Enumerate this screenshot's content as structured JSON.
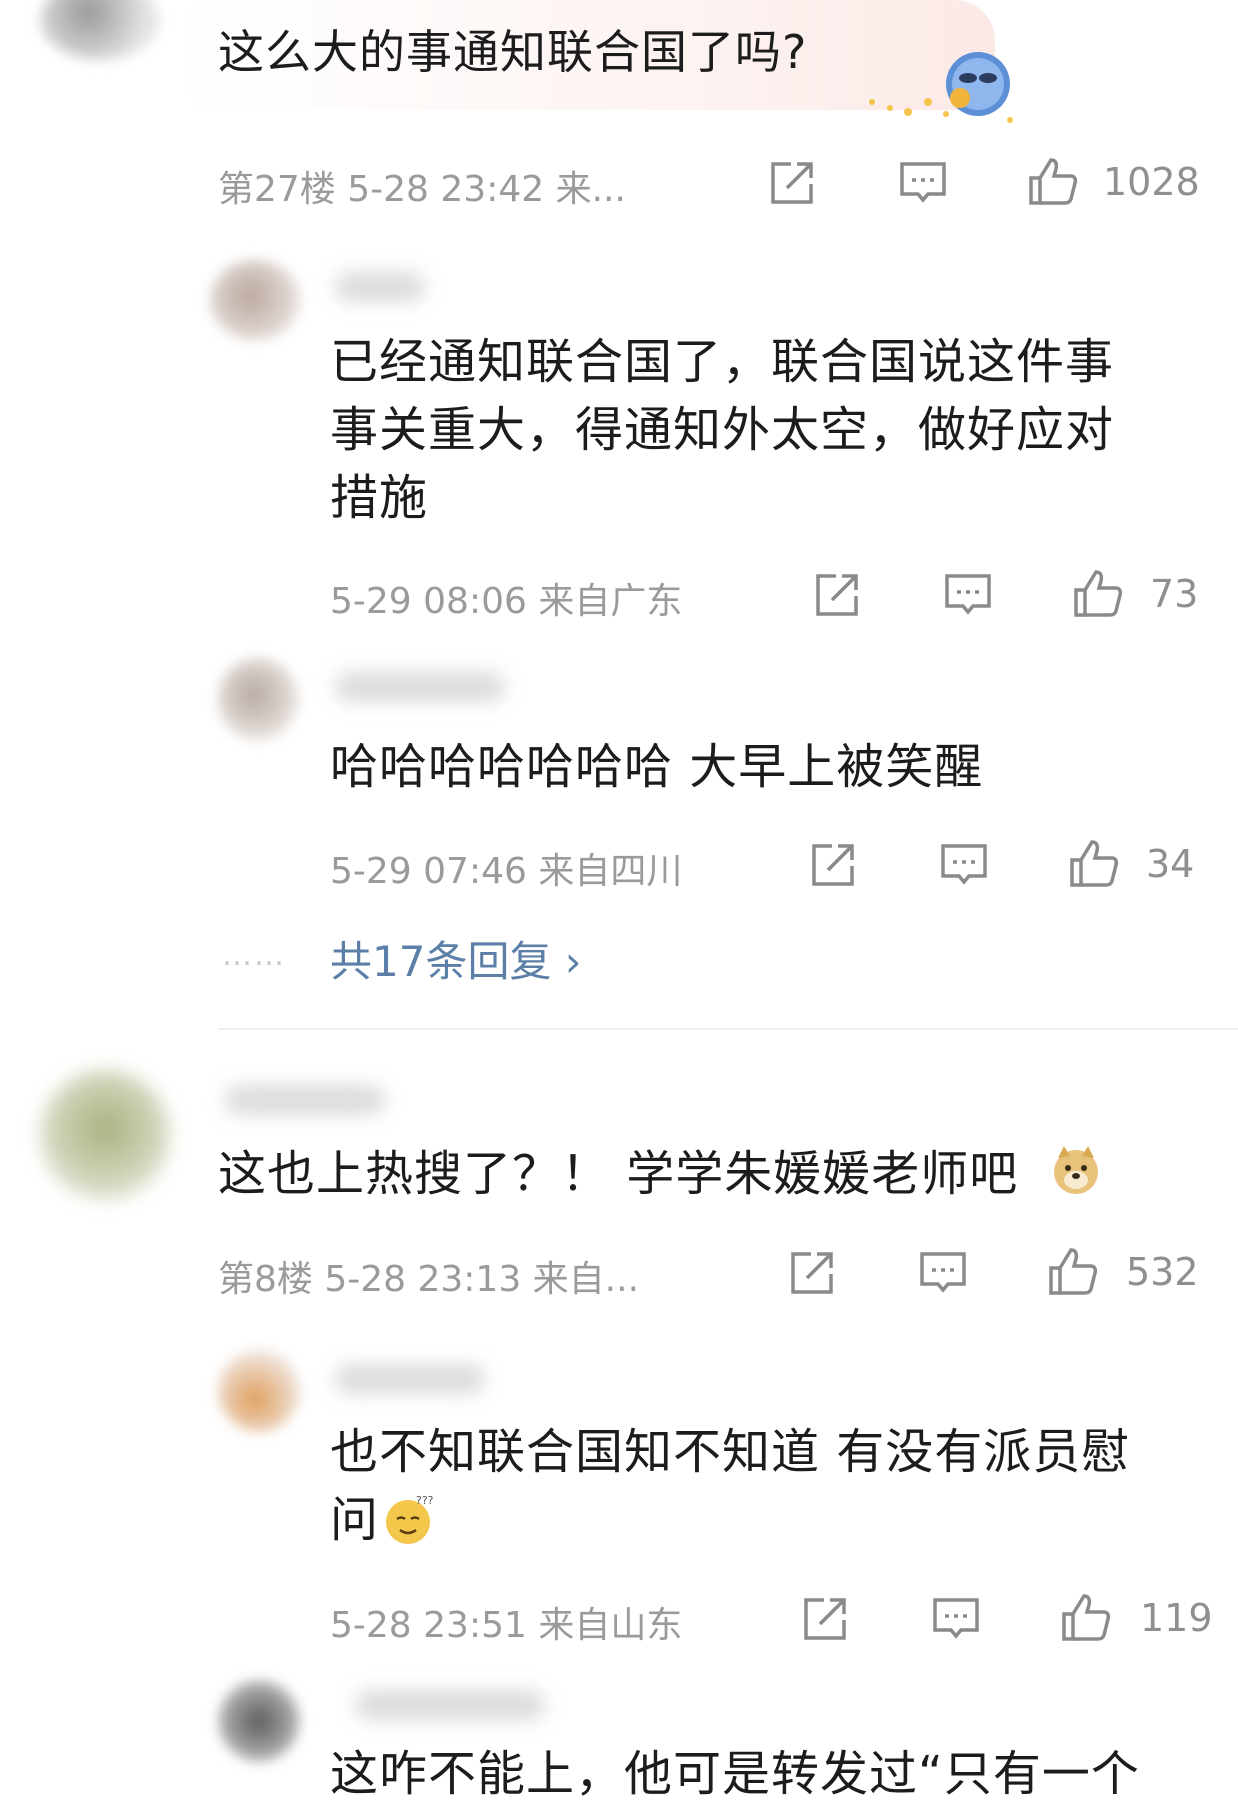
{
  "comments": [
    {
      "text": "这么大的事通知联合国了吗?",
      "meta": "第27楼 5-28 23:42 来...",
      "likes": "1028",
      "replies": [
        {
          "text": "已经通知联合国了，联合国说这件事事关重大，得通知外太空，做好应对措施",
          "lines": [
            "已经通知联合国了，联合国说这件事",
            "事关重大，得通知外太空，做好应对",
            "措施"
          ],
          "meta": "5-29 08:06 来自广东",
          "likes": "73"
        },
        {
          "text": "哈哈哈哈哈哈哈 大早上被笑醒",
          "meta": "5-29 07:46 来自四川",
          "likes": "34"
        }
      ],
      "more_dots": "……",
      "more_replies": "共17条回复 ›"
    },
    {
      "text": "这也上热搜了？！ 学学朱媛媛老师吧",
      "meta": "第8楼 5-28 23:13 来自...",
      "likes": "532",
      "replies": [
        {
          "text": "也不知联合国知不知道 有没有派员慰问",
          "lines": [
            "也不知联合国知不知道 有没有派员慰",
            "问"
          ],
          "meta": "5-28 23:51 来自山东",
          "likes": "119"
        },
        {
          "text": "这咋不能上，他可是转发过“只有一个",
          "meta": ""
        }
      ]
    }
  ],
  "icons": [
    "share-icon",
    "comment-icon",
    "like-icon",
    "doge-emoji",
    "sleepy-emoji",
    "alien-sticker"
  ],
  "colors": {
    "link": "#5b7fa6",
    "meta": "#9a9a9a",
    "text": "#1c1c1c"
  }
}
